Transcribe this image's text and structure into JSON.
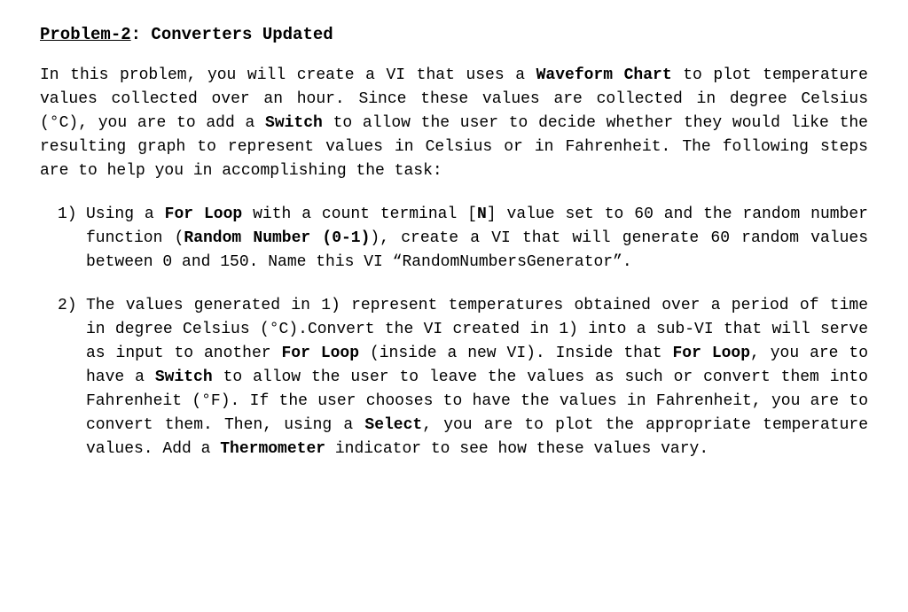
{
  "title": {
    "label": "Problem-2",
    "suffix": ": Converters Updated"
  },
  "intro": {
    "p1a": "In this problem, you will create a VI that uses a ",
    "p1b": "Waveform Chart",
    "p1c": " to plot temperature values collected over an hour. Since these values are collected in degree Celsius (°C), you are to add a ",
    "p1d": "Switch",
    "p1e": " to allow the user to decide whether they would like the resulting graph to represent values in Celsius or in Fahrenheit. The following steps are to help you in accomplishing the task:"
  },
  "item1": {
    "num": "1)",
    "t1": "Using a ",
    "t2": "For Loop",
    "t3": " with a count terminal [",
    "t4": "N",
    "t5": "] value set to 60 and the random number function (",
    "t6": "Random Number (0-1)",
    "t7": "), create a VI that will generate 60 random values between 0 and 150. Name this VI “RandomNumbersGenerator”."
  },
  "item2": {
    "num": "2)",
    "t1": "The values generated in 1) represent temperatures obtained over a period of time in degree Celsius (°C).Convert the VI created in 1) into a sub-VI that will serve as input to another ",
    "t2": "For Loop",
    "t3": " (inside a new VI). Inside that ",
    "t4": "For Loop",
    "t5": ", you are to have a ",
    "t6": "Switch",
    "t7": " to allow the user to leave the values as such or convert them into Fahrenheit (°F). If the user chooses to have the values in Fahrenheit, you are to convert them. Then, using a ",
    "t8": "Select",
    "t9": ", you are to plot the appropriate temperature values. Add a ",
    "t10": "Thermometer",
    "t11": " indicator to see how these values vary."
  }
}
